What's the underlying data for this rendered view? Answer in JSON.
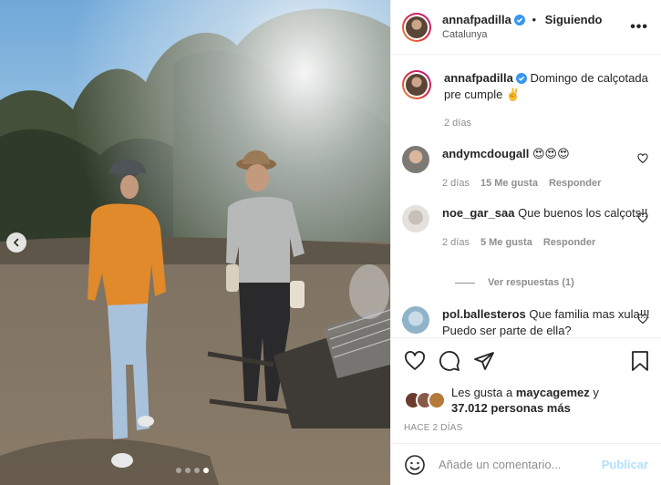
{
  "post": {
    "author": "annafpadilla",
    "separator": "•",
    "follow_status": "Siguiendo",
    "location": "Catalunya",
    "more_glyph": "•••"
  },
  "caption": {
    "author": "annafpadilla",
    "text": "Domingo de calçotada pre cumple ✌️",
    "age": "2 días"
  },
  "comments": [
    {
      "user": "andymcdougall",
      "text": "😍😍😍",
      "age": "2 días",
      "likes": "15 Me gusta",
      "reply": "Responder"
    },
    {
      "user": "noe_gar_saa",
      "text": "Que buenos los calçots!!",
      "age": "2 días",
      "likes": "5 Me gusta",
      "reply": "Responder",
      "view_replies": "Ver respuestas (1)"
    },
    {
      "user": "pol.ballesteros",
      "text": "Que familia mas xula!!! Puedo ser parte de ella?"
    }
  ],
  "likes": {
    "prefix": "Les gusta a ",
    "user": "maycagemez",
    "connector": " y",
    "count": "37.012 personas más"
  },
  "timestamp": "HACE 2 DÍAS",
  "composer": {
    "placeholder": "Añade un comentario...",
    "publish": "Publicar"
  },
  "carousel": {
    "slides": 4,
    "active": 4
  },
  "colors": {
    "verified": "#3897f0",
    "publish_disabled": "#b2dffc",
    "meta_text": "#8e8e8e"
  },
  "icons": [
    "more-options-icon",
    "verified-badge-icon",
    "heart-icon",
    "comment-icon",
    "share-icon",
    "bookmark-icon",
    "emoji-icon",
    "chevron-left-icon"
  ]
}
